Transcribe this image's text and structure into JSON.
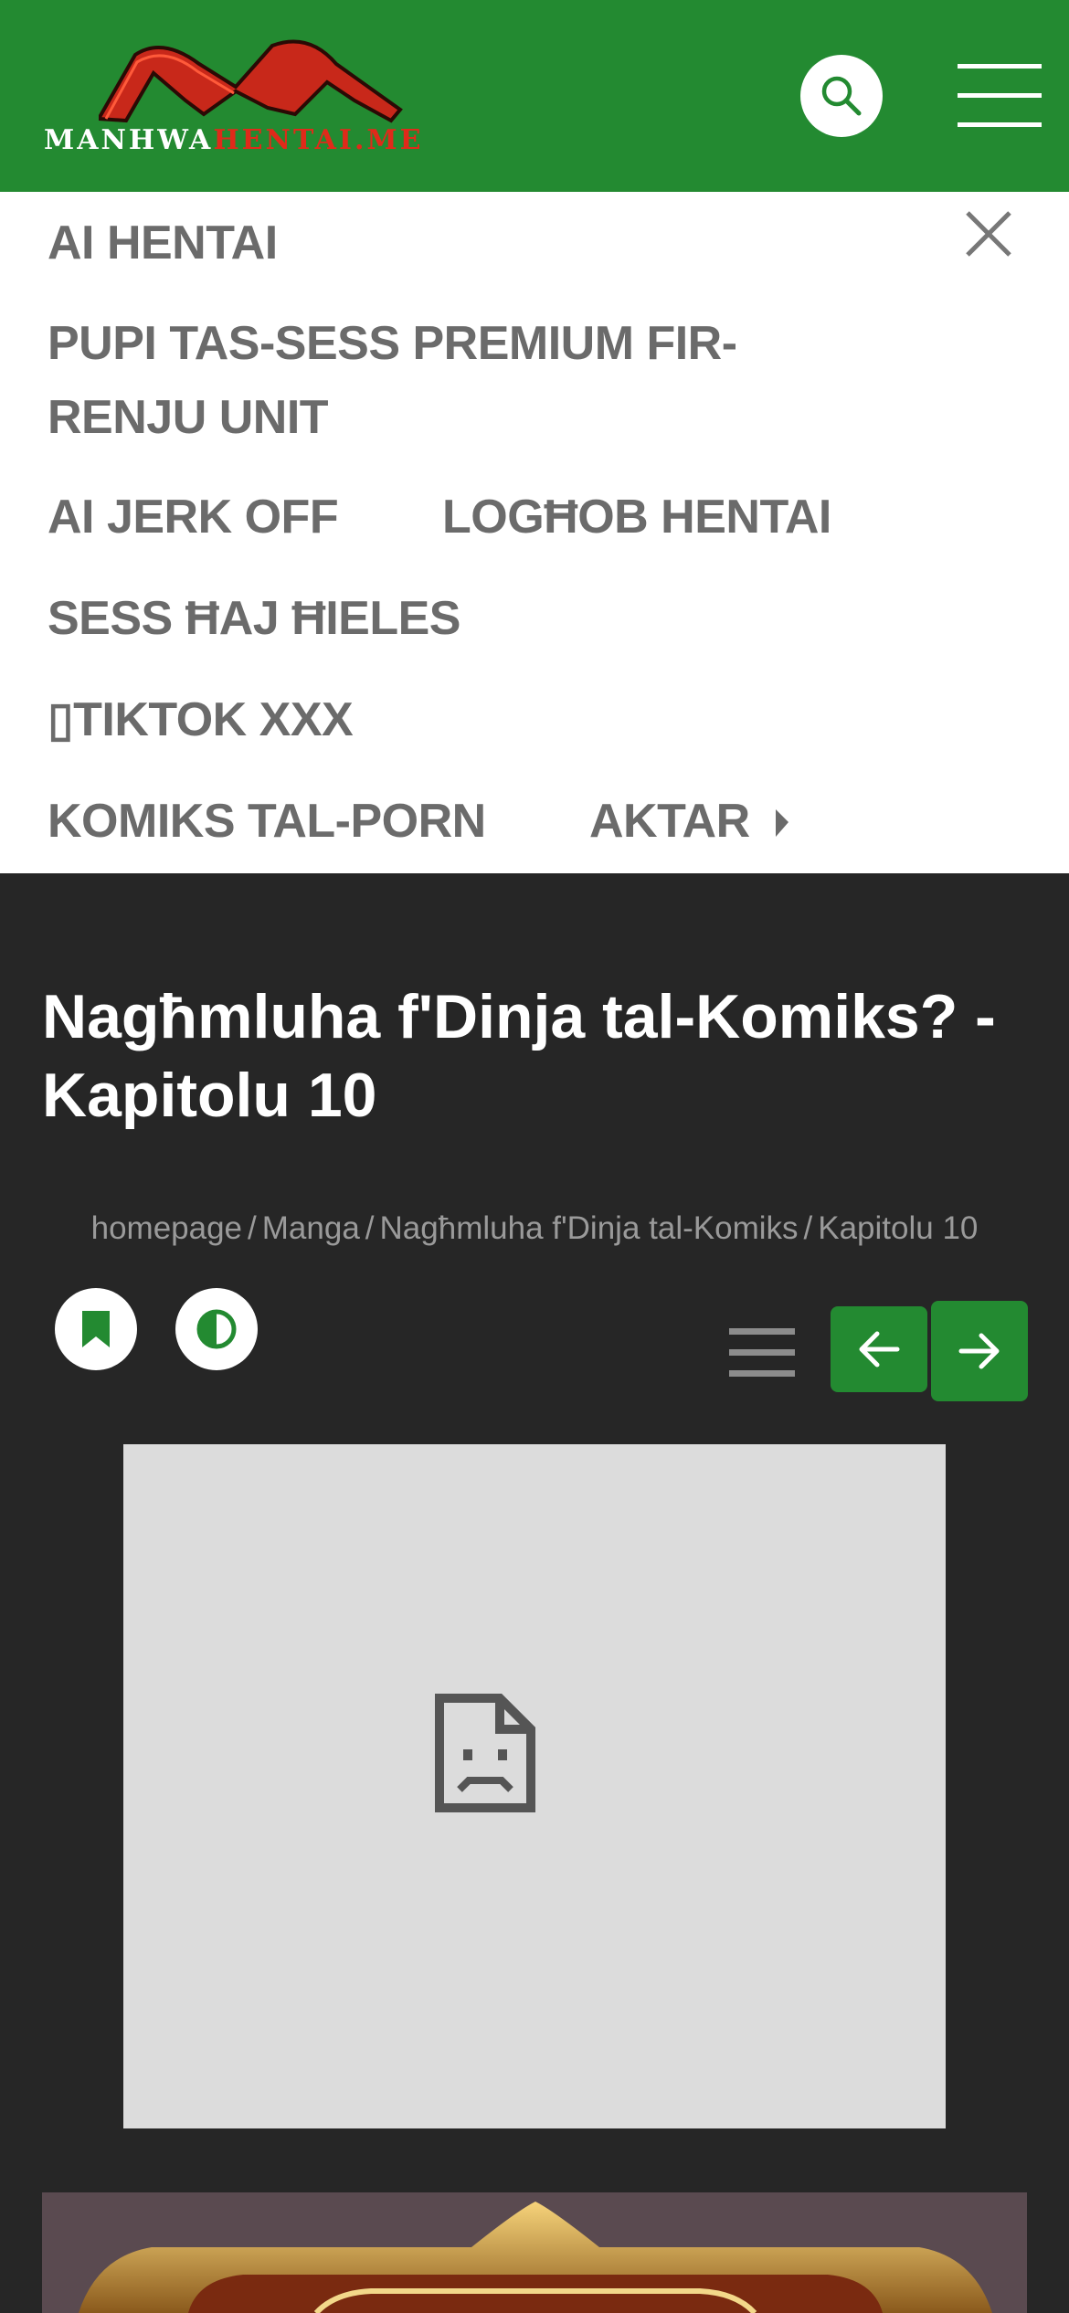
{
  "header": {
    "logo_text_white": "MANHWA",
    "logo_text_red": "HENTAI.ME",
    "icons": {
      "search": "search-icon",
      "menu": "hamburger-menu-icon"
    }
  },
  "menu": {
    "items": [
      "AI HENTAI",
      "PUPI TAS-SESS PREMIUM FIR-",
      "RENJU UNIT",
      "AI JERK OFF",
      "LOGĦOB HENTAI",
      "SESS ĦAJ ĦIELES",
      "▯TIKTOK XXX",
      "KOMIKS TAL-PORN",
      "AKTAR"
    ],
    "close_icon": "close-icon"
  },
  "chapter": {
    "title": "Nagħmluha f'Dinja tal-Komiks? - Kapitolu 10"
  },
  "breadcrumb": {
    "items": [
      "homepage",
      "Manga",
      "Nagħmluha f'Dinja tal-Komiks",
      "Kapitolu 10"
    ],
    "separator": "/"
  },
  "toolbar": {
    "icons": [
      "bookmark-icon",
      "contrast-icon",
      "list-icon",
      "arrow-left-icon",
      "arrow-right-icon"
    ]
  },
  "colors": {
    "brand_green": "#238a31",
    "page_bg": "#262626",
    "menu_text": "#6b6b6b",
    "logo_red": "#e02a1a"
  }
}
